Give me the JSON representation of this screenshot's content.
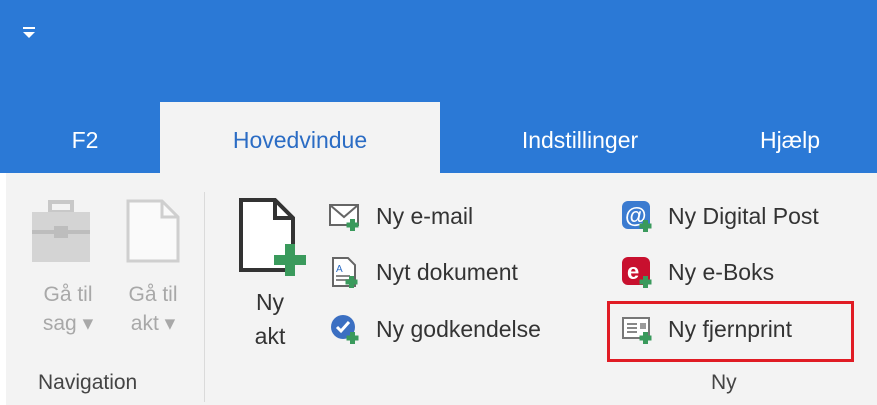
{
  "tabs": [
    {
      "label": "F2"
    },
    {
      "label": "Hovedvindue"
    },
    {
      "label": "Indstillinger"
    },
    {
      "label": "Hjælp"
    }
  ],
  "navigation": {
    "group_label": "Navigation",
    "goto_case": {
      "line1": "Gå til",
      "line2": "sag ▾"
    },
    "goto_akt": {
      "line1": "Gå til",
      "line2": "akt ▾"
    }
  },
  "ny": {
    "group_label": "Ny",
    "ny_akt": {
      "line1": "Ny",
      "line2": "akt"
    },
    "items": [
      {
        "label": "Ny e-mail",
        "icon": "email-icon"
      },
      {
        "label": "Nyt dokument",
        "icon": "document-icon"
      },
      {
        "label": "Ny godkendelse",
        "icon": "approval-check-icon"
      },
      {
        "label": "Ny Digital Post",
        "icon": "digital-post-at-icon"
      },
      {
        "label": "Ny e-Boks",
        "icon": "eboks-icon"
      },
      {
        "label": "Ny fjernprint",
        "icon": "remote-print-icon"
      }
    ]
  },
  "colors": {
    "titlebar": "#2b79d6",
    "ribbon": "#f3f3f3",
    "highlight": "#e01b24",
    "plus_green": "#3a9a5c"
  }
}
